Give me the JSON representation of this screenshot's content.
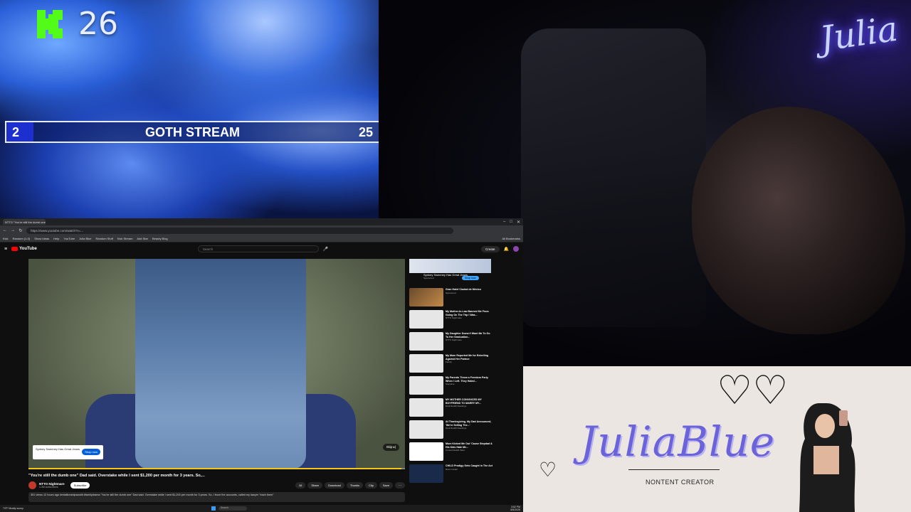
{
  "overlay": {
    "viewer_count": "26",
    "goal": {
      "left": "2",
      "title": "GOTH STREAM",
      "right": "25"
    }
  },
  "webcam": {
    "neon_sign": "Julia"
  },
  "browser": {
    "tab_title": "NTTO \"You're still the dumb one\"",
    "url": "https://www.youtube.com/watch?v=...",
    "bookmarks": [
      "Kick",
      "Random (1-0)",
      "Show Ideas",
      "Help",
      "YouTube",
      "Julia Blue",
      "Random Stuff",
      "Kick Stream",
      "Add Star",
      "Beauty Blog",
      "All Bookmarks"
    ],
    "youtube": {
      "logo": "YouTube",
      "search_placeholder": "Search",
      "create_label": "Create",
      "ad_card": {
        "title": "Sydney Sweeney Has Great Jeans",
        "button": "Shop now"
      },
      "skip_label": "Skip ▸|",
      "progress_fraction": 0.99,
      "video_title": "\"You're still the dumb one\" Dad said. Overstake while I sent $1,200 per month for 3 years. So,...",
      "channel_name": "NTTO Nightmare",
      "channel_subs": "1.3M subscribers",
      "subscribe_label": "Subscribe",
      "actions": [
        "16",
        "Share",
        "Download",
        "Thanks",
        "Clip",
        "Save"
      ],
      "description": "351 views  12 hours ago  #relatiionshipsaddit #familydrama  \"You're still the dumb one\" Dad said. Overstake while I sent $1,200 per month for 3 years. So, I froze the accounts, called my lawyer \"each them\"",
      "sidebar_ad": {
        "title": "Sydney Sweeney Has Great Jeans",
        "sponsored": "Sponsored",
        "button": "Shop now"
      },
      "recommendations": [
        {
          "title": "Gran Hotel Ciudad de México",
          "meta": "Sponsored"
        },
        {
          "title": "My Mother-In-Law Banned Me From Going On The Trip I Was...",
          "meta": "NTTO Nightmare"
        },
        {
          "title": "My Daughter Doesn't Want Me To Go To Her Graduation...",
          "meta": "NTTO Nightmare"
        },
        {
          "title": "My Mom Reported Me for Rebelling Against Her Partner",
          "meta": "Family"
        },
        {
          "title": "My Parents Threw a Freedom Party When I Left. They Hated...",
          "meta": "Storytime"
        },
        {
          "title": "MY MOTHER CONVINCED MY BOYFRIEND TO MARRY MY...",
          "meta": "Dark Reddit Readings"
        },
        {
          "title": "At Thanksgiving, My Dad Announced, 'We're Selling The...'",
          "meta": "Dark Reddit Readings"
        },
        {
          "title": "Mom Kicked Me Out 'Cause Stepdad & His Kids Hate Me...",
          "meta": "Cursed Reddit Tales"
        },
        {
          "title": "CHILD Prodigy Gets Caught in The Act",
          "meta": "Retro Insider"
        }
      ]
    },
    "taskbar": {
      "weather": "73°F Mostly sunny",
      "search": "Search",
      "time": "3:52 PM",
      "date": "8/5/2025"
    }
  },
  "brand": {
    "name": "JuliaBlue",
    "subtitle": "NONTENT CREATOR"
  },
  "colors": {
    "kick_green": "#53fc18",
    "goal_box": "#1e2fd0",
    "brand_purple": "#6b63d9"
  }
}
